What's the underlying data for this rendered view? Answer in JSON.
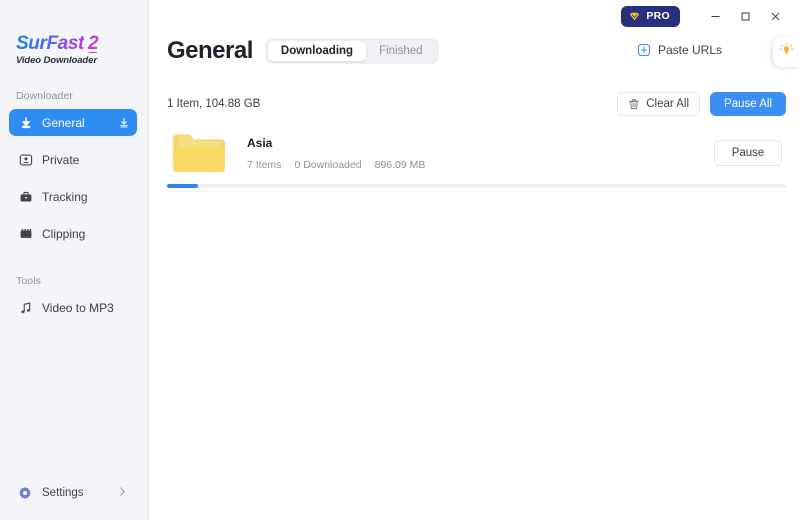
{
  "app": {
    "logo_name": "SurFast",
    "logo_version": "2",
    "logo_subtitle": "Video Downloader"
  },
  "titlebar": {
    "pro_label": "PRO",
    "pro_icon": "gem-icon",
    "minimize_icon": "minimize-icon",
    "maximize_icon": "maximize-icon",
    "close_icon": "close-icon",
    "pro_bg": "#27307e",
    "pro_accent": "#f5c23c"
  },
  "sidebar": {
    "downloader_label": "Downloader",
    "tools_label": "Tools",
    "items": [
      {
        "label": "General",
        "icon": "download-arrow-icon",
        "active": true,
        "trailing_icon": "download-tray-icon"
      },
      {
        "label": "Private",
        "icon": "private-user-icon",
        "active": false
      },
      {
        "label": "Tracking",
        "icon": "briefcase-icon",
        "active": false
      },
      {
        "label": "Clipping",
        "icon": "film-strip-icon",
        "active": false
      }
    ],
    "tools": [
      {
        "label": "Video to MP3",
        "icon": "music-note-icon"
      }
    ],
    "settings": {
      "label": "Settings",
      "icon": "gear-icon",
      "chevron": "chevron-right-icon"
    },
    "active_color": "#2f8cf0"
  },
  "header": {
    "title": "General",
    "tabs": [
      {
        "label": "Downloading",
        "active": true
      },
      {
        "label": "Finished",
        "active": false
      }
    ],
    "paste_urls_label": "Paste URLs",
    "paste_urls_icon": "plus-square-icon",
    "tip_icon": "lightbulb-icon"
  },
  "toolbar": {
    "summary": "1 Item, 104.88 GB",
    "clear_all_label": "Clear All",
    "clear_all_icon": "trash-icon",
    "pause_all_label": "Pause All",
    "pause_all_color": "#3b8ef3"
  },
  "downloads": [
    {
      "name": "Asia",
      "icon": "folder-icon",
      "items_count": "7 Items",
      "downloaded_count": "0 Downloaded",
      "size": "896.09 MB",
      "action_label": "Pause",
      "progress_percent": 5
    }
  ]
}
